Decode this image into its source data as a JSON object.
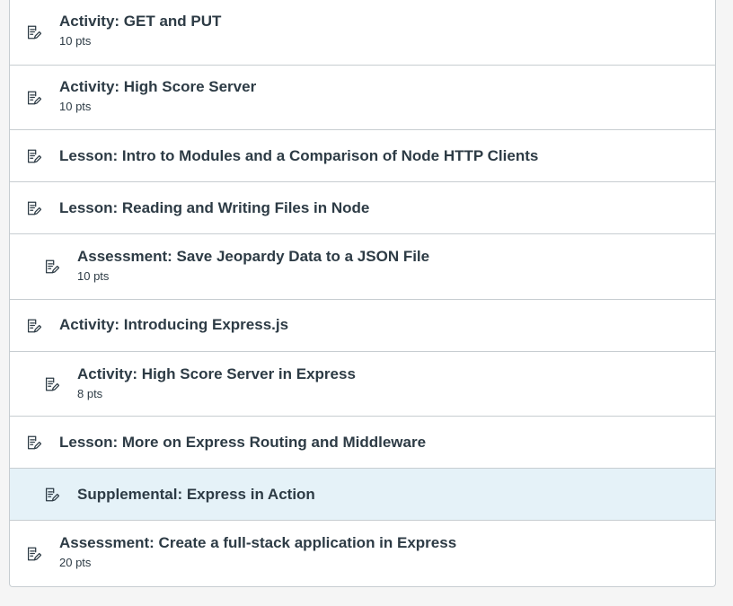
{
  "items": [
    {
      "title": "Activity: GET and PUT",
      "points": "10 pts",
      "icon": "assignment-edit-icon"
    },
    {
      "title": "Activity: High Score Server",
      "points": "10 pts",
      "icon": "assignment-edit-icon"
    },
    {
      "title": "Lesson: Intro to Modules and a Comparison of Node HTTP Clients",
      "icon": "assignment-edit-icon"
    },
    {
      "title": "Lesson: Reading and Writing Files in Node",
      "icon": "assignment-edit-icon"
    },
    {
      "title": "Assessment: Save Jeopardy Data to a JSON File",
      "points": "10 pts",
      "icon": "assignment-edit-icon"
    },
    {
      "title": "Activity: Introducing Express.js",
      "icon": "assignment-edit-icon"
    },
    {
      "title": "Activity: High Score Server in Express",
      "points": "8 pts",
      "icon": "assignment-edit-icon"
    },
    {
      "title": "Lesson: More on Express Routing and Middleware",
      "icon": "assignment-edit-icon"
    },
    {
      "title": "Supplemental: Express in Action",
      "icon": "assignment-edit-icon"
    },
    {
      "title": "Assessment: Create a full-stack application in Express",
      "points": "20 pts",
      "icon": "assignment-edit-icon"
    }
  ],
  "colors": {
    "text": "#2d3b45",
    "border": "#c7cdd1",
    "highlight": "#e5f2f8",
    "background": "#f5f5f5"
  }
}
